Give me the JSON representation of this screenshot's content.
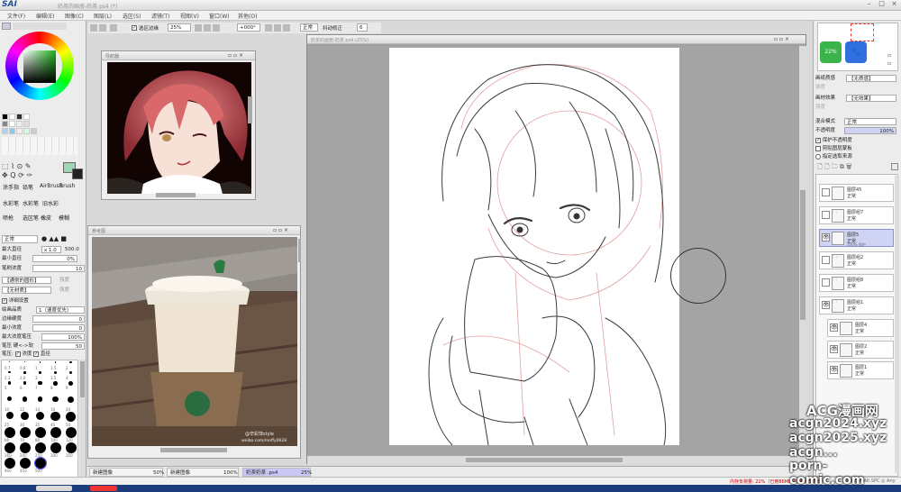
{
  "app": {
    "logo": "SAI",
    "doc_title": "奶茶的画册-奶茶 ps4 (*)"
  },
  "menu": [
    "文件(F)",
    "编辑(E)",
    "图像(C)",
    "图层(L)",
    "选区(S)",
    "滤镜(T)",
    "视图(V)",
    "窗口(W)",
    "其他(O)"
  ],
  "toolopts": {
    "clip_label": "选区边缘",
    "zoom": "25%",
    "angle": "+000°",
    "blend": "正常",
    "stabilizer_label": "抖动修正",
    "stabilizer": "6"
  },
  "tools": {
    "row1": [
      "涂手指",
      "铅笔",
      "AirBrush",
      "Brush"
    ],
    "row2": [
      "水彩笔",
      "水彩笔",
      "旧水彩"
    ],
    "row3": [
      "喷枪",
      "选区笔",
      "橡皮",
      "模糊"
    ]
  },
  "brush": {
    "blend": "正常",
    "size_label": "最大直径",
    "size_mult": "x 1.0",
    "size_val": "500.0",
    "min_label": "最小直径",
    "min_val": "0%",
    "density_label": "笔刷浓度",
    "density_val": "10",
    "shape1": "【通常的圆形】",
    "shape1_val": "强度",
    "texture": "【无材质】",
    "texture_val": "强度",
    "detail_label": "详细设置",
    "quality_label": "绘画品质",
    "quality_val": "1（速度优先）",
    "edge_label": "边缘硬度",
    "edge_val": "0",
    "mind_label": "最小浓度",
    "mind_val": "0",
    "maxp_label": "最大浓度笔压",
    "maxp_val": "100%",
    "press_label": "笔压 硬<->软",
    "press_val": "50",
    "press2_label": "笔压:",
    "density_chk": "浓度",
    "size_chk": "直径"
  },
  "brush_sizes": [
    "0.7",
    "0.8",
    "1",
    "1.5",
    "2",
    "2.3",
    "2.6",
    "3",
    "3.5",
    "4",
    "5",
    "6",
    "7",
    "8",
    "9",
    "10",
    "12",
    "14",
    "16",
    "20",
    "25",
    "30",
    "35",
    "40",
    "50",
    "60",
    "70",
    "80",
    "100",
    "120",
    "160",
    "200",
    "250",
    "300",
    "350",
    "400",
    "450",
    "500"
  ],
  "navigator": {
    "title": "导航器"
  },
  "photo": {
    "title": "参考图",
    "watermark": "@辛彩饰style",
    "watermark2": "weibo.com/moffy0628"
  },
  "canvas": {
    "title": "奶茶的画册-奶茶 ps4 (25%)"
  },
  "tabs": [
    {
      "name": "新建图像",
      "zoom": "50%"
    },
    {
      "name": "新建图像",
      "zoom": "100%"
    },
    {
      "name": "奶茶奶茶 .ps4",
      "zoom": "25%"
    }
  ],
  "right": {
    "badge": "22%",
    "paper_tex_label": "画纸质感",
    "paper_tex_val": "【无质感】",
    "strength_label": "强度",
    "paper_eff_label": "画材效果",
    "paper_eff_val": "【无效果】",
    "blend_label": "混合模式",
    "blend_val": "正常",
    "opacity_label": "不透明度",
    "opacity_val": "100%",
    "opts": [
      "保护不透明度",
      "剪贴图层蒙板",
      "指定选取来源"
    ]
  },
  "layers": [
    {
      "name": "图层45",
      "mode": "正常",
      "op": ""
    },
    {
      "name": "图层组7",
      "mode": "正常",
      "op": ""
    },
    {
      "name": "图层5",
      "mode": "正常",
      "op": "100% 保护"
    },
    {
      "name": "图层组2",
      "mode": "正常",
      "op": ""
    },
    {
      "name": "图层组8",
      "mode": "正常",
      "op": ""
    },
    {
      "name": "图层组1",
      "mode": "正常",
      "op": ""
    },
    {
      "name": "图层4",
      "mode": "正常",
      "op": ""
    },
    {
      "name": "图层2",
      "mode": "正常",
      "op": ""
    },
    {
      "name": "图层1",
      "mode": "正常",
      "op": ""
    }
  ],
  "status": {
    "memory": "内存负荷量: 22%（已用86MB/可用2469MB）",
    "keys": "Shift Ctrl Alt SPC ◎ Any"
  },
  "watermarks": [
    "ACG漫画网",
    "acgn2024.xyz",
    "acgn2025.xyz",
    "acgn...",
    "porn-comic.com"
  ],
  "colors": {
    "accent": "#c9c7f4",
    "selected_layer": "#cfd4f5"
  }
}
